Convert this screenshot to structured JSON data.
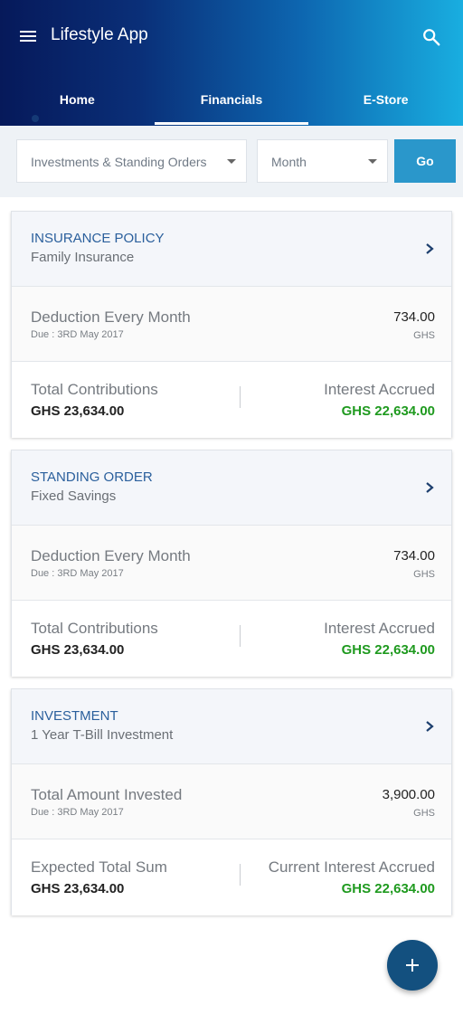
{
  "app": {
    "title": "Lifestyle App"
  },
  "icons": {
    "menu": "hamburger-menu-icon",
    "search": "magnifier-icon",
    "chevron": "chevron-right-icon",
    "fab": "plus-icon"
  },
  "colors": {
    "header_start": "#06195a",
    "header_end": "#19aee0",
    "accent": "#2a97cb",
    "positive": "#1f9a1f",
    "fab": "#13507f",
    "link": "#2a5f9c"
  },
  "tabs": [
    {
      "label": "Home"
    },
    {
      "label": "Financials",
      "active": true
    },
    {
      "label": "E-Store"
    }
  ],
  "filters": {
    "type": "Investments & Standing Orders",
    "month": "Month",
    "go_label": "Go"
  },
  "cards": [
    {
      "type": "INSURANCE POLICY",
      "name": "Family Insurance",
      "mid_label": "Deduction Every Month",
      "due": "Due : 3RD May 2017",
      "amount": "734.00",
      "currency": "GHS",
      "left_label": "Total Contributions",
      "left_value": "GHS 23,634.00",
      "right_label": "Interest Accrued",
      "right_value": "GHS 22,634.00"
    },
    {
      "type": "STANDING ORDER",
      "name": "Fixed Savings",
      "mid_label": "Deduction Every Month",
      "due": "Due : 3RD May 2017",
      "amount": "734.00",
      "currency": "GHS",
      "left_label": "Total Contributions",
      "left_value": "GHS 23,634.00",
      "right_label": "Interest Accrued",
      "right_value": "GHS 22,634.00"
    },
    {
      "type": "INVESTMENT",
      "name": "1 Year T-Bill Investment",
      "mid_label": "Total Amount Invested",
      "due": "Due : 3RD May 2017",
      "amount": "3,900.00",
      "currency": "GHS",
      "left_label": "Expected Total Sum",
      "left_value": "GHS 23,634.00",
      "right_label": "Current Interest Accrued",
      "right_value": "GHS 22,634.00"
    }
  ]
}
